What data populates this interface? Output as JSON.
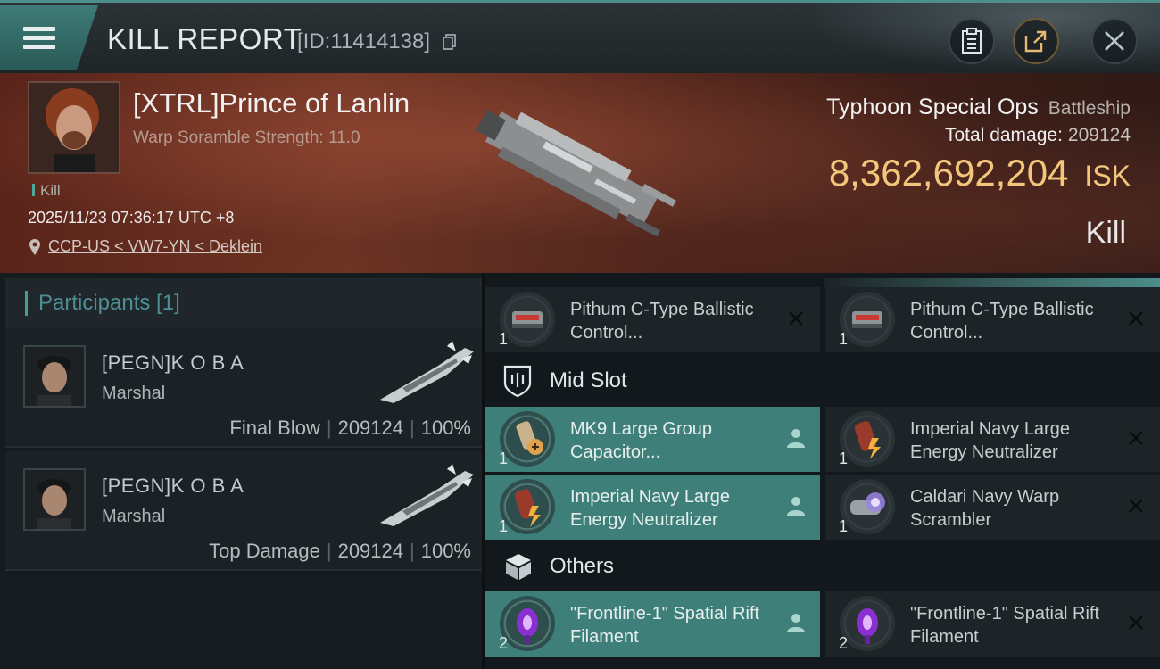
{
  "header": {
    "title": "KILL REPORT",
    "report_id": "[ID:11414138]",
    "icons": [
      "menu-icon",
      "copy-icon",
      "clipboard-icon",
      "share-icon",
      "close-icon"
    ]
  },
  "victim": {
    "name": "[XTRL]Prince of Lanlin",
    "subtitle": "Warp Soramble Strength: 11.0",
    "tag": "Kill",
    "time": "2025/11/23 07:36:17 UTC +8",
    "location": "CCP-US < VW7-YN < Deklein",
    "ship_name": "Typhoon Special Ops",
    "ship_class": "Battleship",
    "total_damage_label": "Total damage:",
    "total_damage": "209124",
    "isk_value": "8,362,692,204",
    "isk_unit": "ISK",
    "result": "Kill"
  },
  "participants": {
    "header": "Participants [1]",
    "rows": [
      {
        "name": "[PEGN]K O B A",
        "ship": "Marshal",
        "role": "Final Blow",
        "damage": "209124",
        "percent": "100%"
      },
      {
        "name": "[PEGN]K O B A",
        "ship": "Marshal",
        "role": "Top Damage",
        "damage": "209124",
        "percent": "100%"
      }
    ]
  },
  "items": {
    "low_slot": [
      {
        "name": "Pithum C-Type Ballistic Control...",
        "qty": "1",
        "state": "destroyed"
      },
      {
        "name": "Pithum C-Type Ballistic Control...",
        "qty": "1",
        "state": "destroyed"
      }
    ],
    "mid_slot_label": "Mid Slot",
    "mid_slot": [
      {
        "name": "MK9 Large Group Capacitor...",
        "qty": "1",
        "state": "dropped"
      },
      {
        "name": "Imperial Navy Large Energy Neutralizer",
        "qty": "1",
        "state": "destroyed"
      },
      {
        "name": "Imperial Navy Large Energy Neutralizer",
        "qty": "1",
        "state": "dropped"
      },
      {
        "name": "Caldari Navy Warp Scrambler",
        "qty": "1",
        "state": "destroyed"
      }
    ],
    "others_label": "Others",
    "others": [
      {
        "name": "\"Frontline-1\" Spatial Rift Filament",
        "qty": "2",
        "state": "dropped"
      },
      {
        "name": "\"Frontline-1\" Spatial Rift Filament",
        "qty": "2",
        "state": "destroyed"
      }
    ]
  },
  "colors": {
    "accent": "#4d8f8a",
    "dropped": "#3f7f79",
    "isk": "#f4c67c",
    "banner": "#6f3424"
  }
}
